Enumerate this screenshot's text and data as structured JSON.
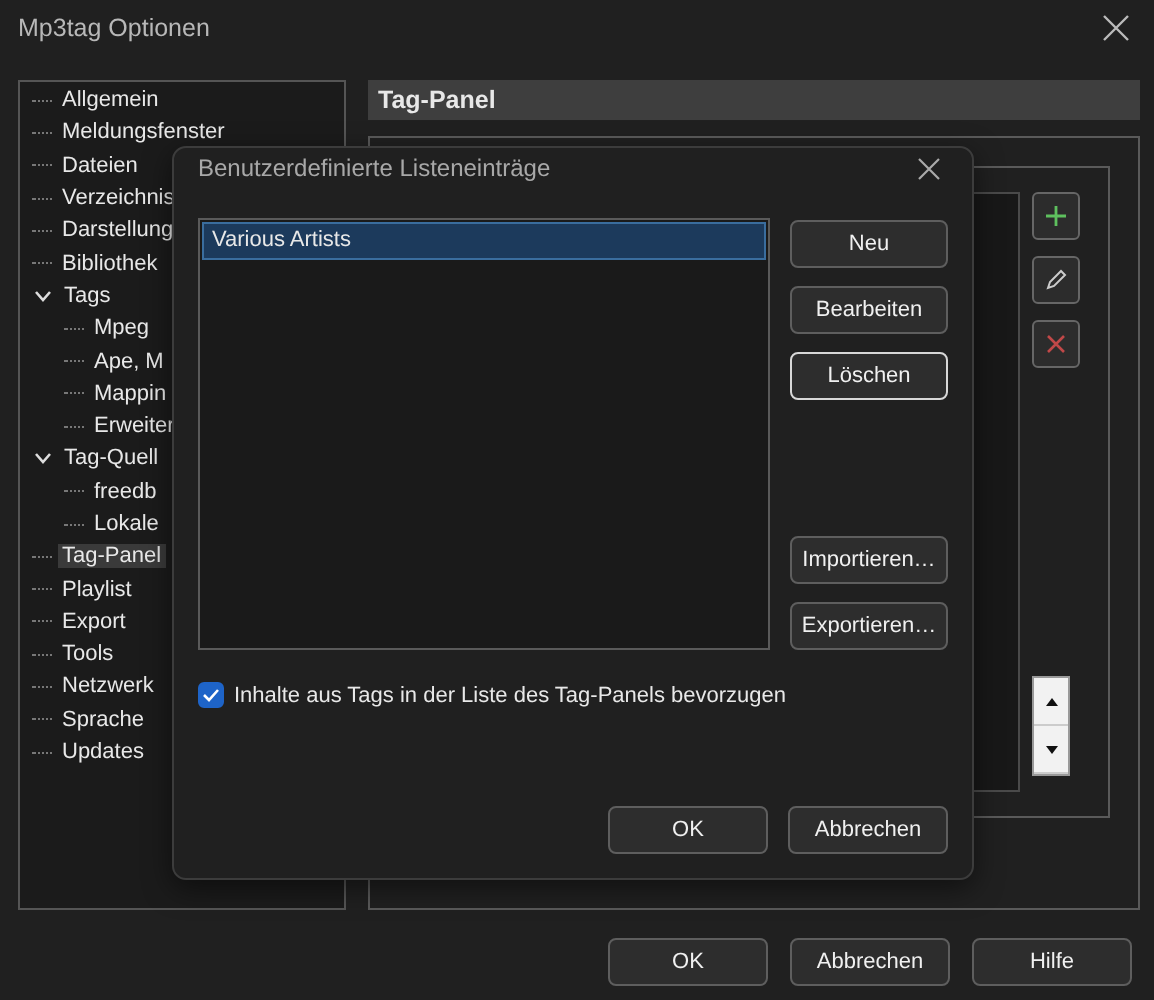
{
  "window": {
    "title": "Mp3tag Optionen"
  },
  "tree": [
    {
      "label": "Allgemein",
      "selected": false
    },
    {
      "label": "Meldungsfenster",
      "selected": false
    },
    {
      "label": "Dateien",
      "selected": false
    },
    {
      "label": "Verzeichnis",
      "selected": false
    },
    {
      "label": "Darstellung",
      "selected": false
    },
    {
      "label": "Bibliothek",
      "selected": false
    },
    {
      "label": "Tags",
      "selected": false,
      "expanded": true,
      "children": [
        {
          "label": "Mpeg",
          "selected": false
        },
        {
          "label": "Ape, M",
          "selected": false
        },
        {
          "label": "Mappin",
          "selected": false
        },
        {
          "label": "Erweiter",
          "selected": false
        }
      ]
    },
    {
      "label": "Tag-Quell",
      "selected": false,
      "expanded": true,
      "children": [
        {
          "label": "freedb",
          "selected": false
        },
        {
          "label": "Lokale",
          "selected": false
        }
      ]
    },
    {
      "label": "Tag-Panel",
      "selected": true
    },
    {
      "label": "Playlist",
      "selected": false
    },
    {
      "label": "Export",
      "selected": false
    },
    {
      "label": "Tools",
      "selected": false
    },
    {
      "label": "Netzwerk",
      "selected": false
    },
    {
      "label": "Sprache",
      "selected": false
    },
    {
      "label": "Updates",
      "selected": false
    }
  ],
  "panel": {
    "title": "Tag-Panel"
  },
  "dialog": {
    "title": "Benutzerdefinierte Listeneinträge",
    "entries": [
      {
        "label": "Various Artists",
        "selected": true
      }
    ],
    "buttons_top": [
      {
        "label": "Neu",
        "focused": false
      },
      {
        "label": "Bearbeiten",
        "focused": false
      },
      {
        "label": "Löschen",
        "focused": true
      }
    ],
    "buttons_bottom": [
      {
        "label": "Importieren…",
        "focused": false
      },
      {
        "label": "Exportieren…",
        "focused": false
      }
    ],
    "checkbox": {
      "label": "Inhalte aus Tags in der Liste des Tag-Panels bevorzugen",
      "checked": true
    },
    "footer_buttons": [
      "OK",
      "Abbrechen"
    ]
  },
  "footer_buttons": [
    "OK",
    "Abbrechen",
    "Hilfe"
  ]
}
